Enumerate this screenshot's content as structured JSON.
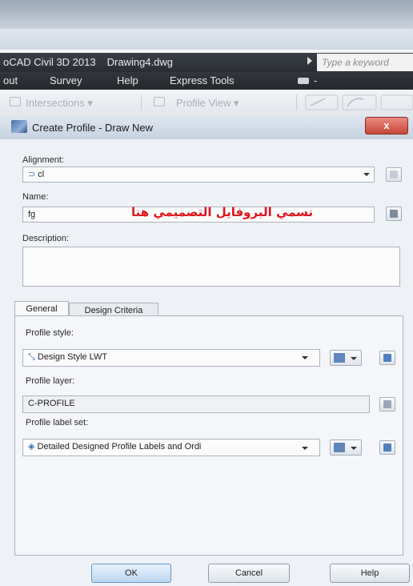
{
  "app": {
    "title_app": "oCAD Civil 3D 2013",
    "title_file": "Drawing4.dwg",
    "keyword_placeholder": "Type a keyword"
  },
  "menu": {
    "items": [
      "out",
      "Survey",
      "Help",
      "Express Tools"
    ],
    "dash": "-"
  },
  "ribbon": {
    "intersections": "Intersections ▾",
    "profile_view": "Profile View ▾"
  },
  "dialog": {
    "title": "Create Profile - Draw New",
    "close": "x",
    "alignment_label": "Alignment:",
    "alignment_value": "cl",
    "name_label": "Name:",
    "name_value": "fg",
    "annotation": "نسمي البروفايل التصميمي هنا",
    "description_label": "Description:",
    "description_value": "",
    "tabs": [
      "General",
      "Design Criteria"
    ],
    "profile_style_label": "Profile style:",
    "profile_style_value": "Design Style LWT",
    "profile_layer_label": "Profile layer:",
    "profile_layer_value": "C-PROFILE",
    "label_set_label": "Profile label set:",
    "label_set_value": "Detailed Designed Profile Labels and Ordi",
    "ok": "OK",
    "cancel": "Cancel",
    "help": "Help"
  },
  "colors": {
    "annotation": "#e0141a",
    "title_bar": "#2a2e34",
    "close_button": "#c8463a"
  }
}
